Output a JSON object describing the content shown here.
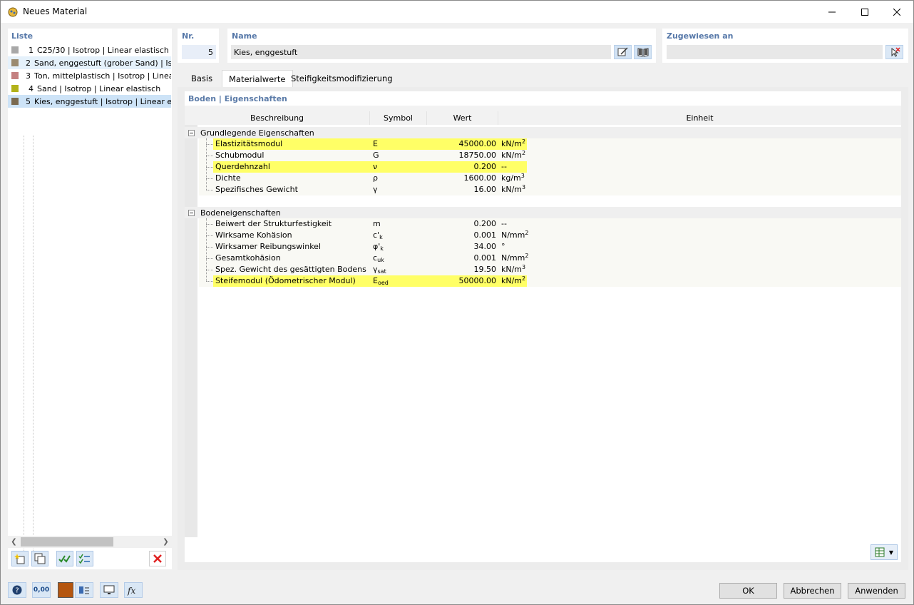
{
  "window": {
    "title": "Neues Material"
  },
  "list": {
    "label": "Liste",
    "items": [
      {
        "num": "1",
        "text": "C25/30 | Isotrop | Linear elastisch",
        "color": "#a8a8a8"
      },
      {
        "num": "2",
        "text": "Sand, enggestuft (grober Sand) | Isotrop",
        "color": "#9a8a70"
      },
      {
        "num": "3",
        "text": "Ton, mittelplastisch | Isotrop | Linear elastisch",
        "color": "#c48080"
      },
      {
        "num": "4",
        "text": "Sand | Isotrop | Linear elastisch",
        "color": "#b2b21a"
      },
      {
        "num": "5",
        "text": "Kies, enggestuft | Isotrop | Linear elastisch",
        "color": "#7a6a50"
      }
    ],
    "selected_index": 4
  },
  "nr": {
    "label": "Nr.",
    "value": "5"
  },
  "name": {
    "label": "Name",
    "value": "Kies, enggestuft"
  },
  "assigned": {
    "label": "Zugewiesen an",
    "value": ""
  },
  "tabs": [
    "Basis",
    "Materialwerte",
    "Steifigkeitsmodifizierung"
  ],
  "active_tab": "Materialwerte",
  "section_title": "Boden | Eigenschaften",
  "columns": [
    "Beschreibung",
    "Symbol",
    "Wert",
    "Einheit"
  ],
  "groups": [
    {
      "title": "Grundlegende Eigenschaften",
      "rows": [
        {
          "desc": "Elastizitätsmodul",
          "sym": "E",
          "sym_sub": "",
          "val": "45000.00",
          "unit": "kN/m",
          "unit_sup": "2",
          "hl": true
        },
        {
          "desc": "Schubmodul",
          "sym": "G",
          "sym_sub": "",
          "val": "18750.00",
          "unit": "kN/m",
          "unit_sup": "2",
          "hl": false
        },
        {
          "desc": "Querdehnzahl",
          "sym": "ν",
          "sym_sub": "",
          "val": "0.200",
          "unit": "--",
          "unit_sup": "",
          "hl": true
        },
        {
          "desc": "Dichte",
          "sym": "ρ",
          "sym_sub": "",
          "val": "1600.00",
          "unit": "kg/m",
          "unit_sup": "3",
          "hl": false
        },
        {
          "desc": "Spezifisches Gewicht",
          "sym": "γ",
          "sym_sub": "",
          "val": "16.00",
          "unit": "kN/m",
          "unit_sup": "3",
          "hl": false
        }
      ]
    },
    {
      "title": "Bodeneigenschaften",
      "rows": [
        {
          "desc": "Beiwert der Strukturfestigkeit",
          "sym": "m",
          "sym_sub": "",
          "val": "0.200",
          "unit": "--",
          "unit_sup": "",
          "hl": false
        },
        {
          "desc": "Wirksame Kohäsion",
          "sym": "c'",
          "sym_sub": "k",
          "val": "0.001",
          "unit": "N/mm",
          "unit_sup": "2",
          "hl": false
        },
        {
          "desc": "Wirksamer Reibungswinkel",
          "sym": "φ'",
          "sym_sub": "k",
          "val": "34.00",
          "unit": "°",
          "unit_sup": "",
          "hl": false
        },
        {
          "desc": "Gesamtkohäsion",
          "sym": "c",
          "sym_sub": "uk",
          "val": "0.001",
          "unit": "N/mm",
          "unit_sup": "2",
          "hl": false
        },
        {
          "desc": "Spez. Gewicht des gesättigten Bodens",
          "sym": "γ",
          "sym_sub": "sat",
          "val": "19.50",
          "unit": "kN/m",
          "unit_sup": "3",
          "hl": false
        },
        {
          "desc": "Steifemodul (Ödometrischer Modul)",
          "sym": "E",
          "sym_sub": "oed",
          "val": "50000.00",
          "unit": "kN/m",
          "unit_sup": "2",
          "hl": true
        }
      ]
    }
  ],
  "buttons": {
    "ok": "OK",
    "cancel": "Abbrechen",
    "apply": "Anwenden"
  },
  "bottom_icons": {
    "units_text": "0,00",
    "material_color": "#b5560f"
  }
}
